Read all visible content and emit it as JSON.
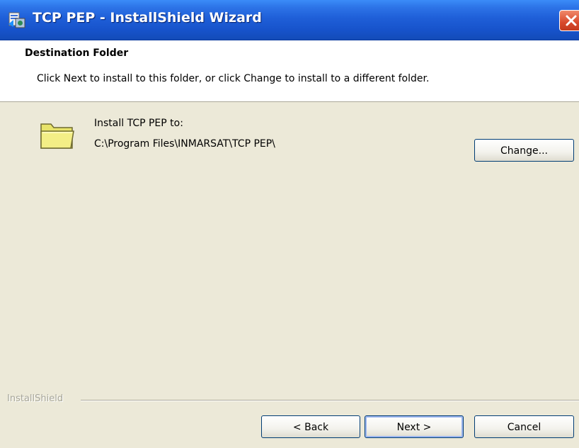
{
  "window": {
    "title": "TCP PEP - InstallShield Wizard"
  },
  "header": {
    "title": "Destination Folder",
    "description": "Click Next to install to this folder, or click Change to install to a different folder."
  },
  "destination": {
    "label": "Install TCP PEP to:",
    "path": "C:\\Program Files\\INMARSAT\\TCP PEP\\",
    "change_label": "Change..."
  },
  "footer": {
    "brand": "InstallShield",
    "back_label": "< Back",
    "next_label": "Next >",
    "cancel_label": "Cancel"
  },
  "icons": {
    "app": "installer-icon",
    "close": "close-icon",
    "folder": "folder-icon"
  },
  "colors": {
    "titlebar": "#1F5FD8",
    "close": "#D8492C",
    "dialog_bg": "#ECE9D8",
    "banner_bg": "#FFFFFF",
    "button_border": "#003C74"
  }
}
